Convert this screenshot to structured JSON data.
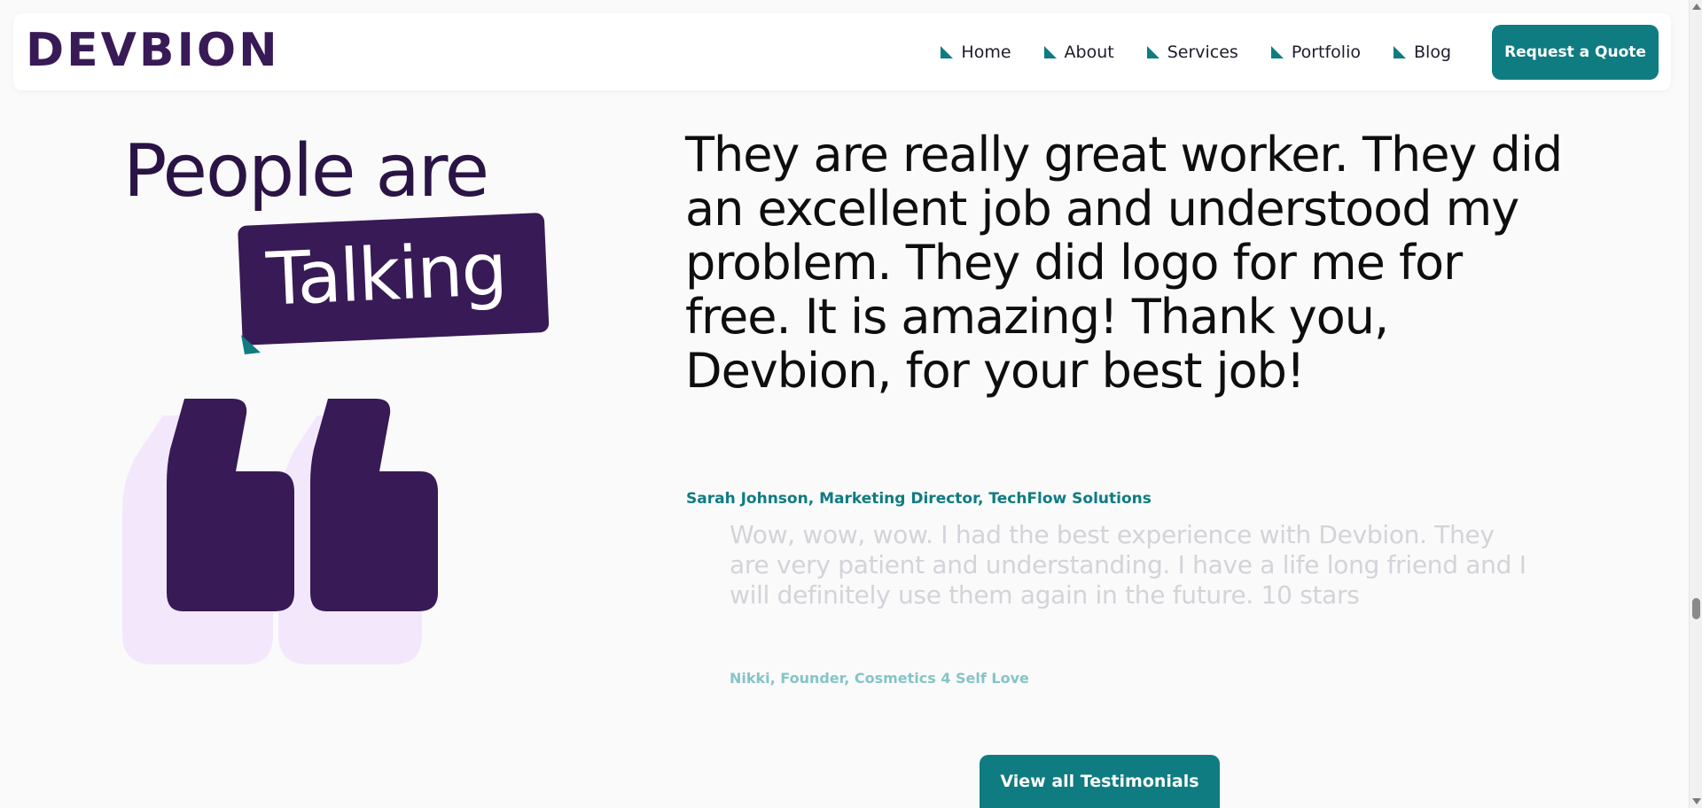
{
  "colors": {
    "brand_purple": "#381a56",
    "brand_teal": "#0f7c82",
    "light_purple": "#f3e8fb",
    "muted_quote": "#d3d3d9",
    "muted_author": "#86c4c6"
  },
  "header": {
    "logo_text": "DEVBION",
    "nav": [
      {
        "label": "Home",
        "icon": "triangle-bullet-icon"
      },
      {
        "label": "About",
        "icon": "triangle-bullet-icon"
      },
      {
        "label": "Services",
        "icon": "triangle-bullet-icon"
      },
      {
        "label": "Portfolio",
        "icon": "triangle-bullet-icon"
      },
      {
        "label": "Blog",
        "icon": "triangle-bullet-icon"
      }
    ],
    "cta_label": "Request a Quote"
  },
  "testimonials_section": {
    "heading_line1": "People are",
    "heading_highlight": "Talking",
    "quote_icon": "quote-mark-icon",
    "active_testimonial": {
      "text": "They are really great worker. They did an excellent job and understood my problem. They did logo for me for free. It is amazing! Thank you, Devbion, for your best job!",
      "author": "Sarah Johnson, Marketing Director, TechFlow Solutions"
    },
    "next_testimonial": {
      "text": "Wow, wow, wow. I had the best experience with Devbion. They are very patient and understanding. I have a life long friend and I will definitely use them again in the future. 10 stars",
      "author": "Nikki, Founder, Cosmetics 4 Self Love"
    },
    "view_all_label": "View all Testimonials"
  }
}
